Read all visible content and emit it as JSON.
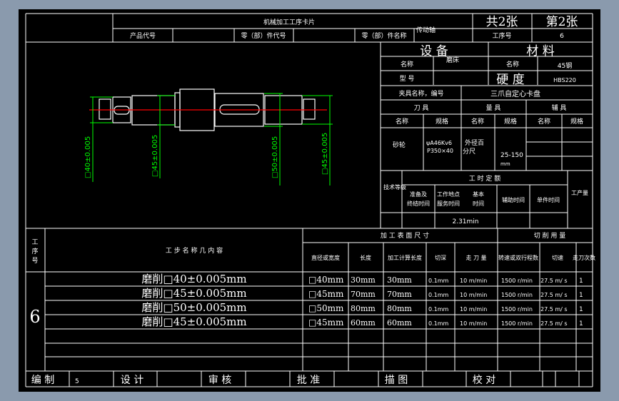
{
  "header": {
    "title": "机械加工工序卡片",
    "total_sheets": "共2张",
    "sheet_no": "第2张",
    "product_code_label": "产品代号",
    "part_code_label": "零（部）件代号",
    "part_name_label": "零（部）件名称",
    "part_name": "传动轴",
    "operation_no_label": "工序号",
    "operation_no": "6"
  },
  "equipment": {
    "title": "设 备",
    "name_label": "名称",
    "name": "磨床",
    "model_label": "型 号",
    "model": ""
  },
  "material": {
    "title": "材 料",
    "name_label": "名称",
    "name": "45钢",
    "hardness_label": "硬 度",
    "hardness": "HBS220"
  },
  "fixture": {
    "label": "夹具名称，编号",
    "value": "三爪自定心卡盘"
  },
  "tools": {
    "cutting_tool": "刀 具",
    "measuring_tool": "量 具",
    "aux_tool": "辅 具",
    "name_label": "名称",
    "spec_label": "规格",
    "cutting_name": "砂轮",
    "cutting_spec_1": "ψA46Kv6",
    "cutting_spec_2": "P350×40",
    "measuring_name_1": "外径百",
    "measuring_name_2": "分尺",
    "measuring_spec_1": "25-150",
    "measuring_spec_2": "mm"
  },
  "time_quota": {
    "tech_level": "技术等级",
    "title": "工 时 定 额",
    "prep_time_1": "准备及",
    "prep_time_2": "终结时间",
    "service_time_1": "工作地点",
    "service_time_2": "服务时间",
    "basic_time_1": "基本",
    "basic_time_2": "时间",
    "aux_time": "辅助时间",
    "unit_time": "单件时间",
    "output": "工产量",
    "basic_time_value": "2.31min"
  },
  "drawing": {
    "dims": [
      "□40±0.005",
      "□45±0.005",
      "□50±0.005",
      "□45±0.005"
    ],
    "line_color": "#00ff00",
    "centerline_color": "#ff0000"
  },
  "steps_table": {
    "op_no_label": "工序号",
    "content_label": "工 步 名 称 几 内 容",
    "surface_size_label": "加 工 表 面 尺 寸",
    "cutting_label": "切 削 用 量",
    "columns": [
      "直径或宽度",
      "长度",
      "加工计算长度",
      "切深",
      "走 刀 量",
      "转速或双行程数",
      "切速",
      "走刀次数"
    ],
    "op_no": "6",
    "rows": [
      {
        "content": "磨削□40±0.005mm",
        "dia": "□40mm",
        "len": "30mm",
        "calc_len": "30mm",
        "depth": "0.1mm",
        "feed": "10 m/min",
        "speed": "1500 r/min",
        "cut_speed": "27.5 m/ s",
        "passes": "1"
      },
      {
        "content": "磨削□45±0.005mm",
        "dia": "□45mm",
        "len": "70mm",
        "calc_len": "70mm",
        "depth": "0.1mm",
        "feed": "10 m/min",
        "speed": "1500 r/min",
        "cut_speed": "27.5 m/ s",
        "passes": "1"
      },
      {
        "content": "磨削□50±0.005mm",
        "dia": "□50mm",
        "len": "80mm",
        "calc_len": "80mm",
        "depth": "0.1mm",
        "feed": "10 m/min",
        "speed": "1500 r/min",
        "cut_speed": "27.5 m/ s",
        "passes": "1"
      },
      {
        "content": "磨削□45±0.005mm",
        "dia": "□45mm",
        "len": "60mm",
        "calc_len": "60mm",
        "depth": "0.1mm",
        "feed": "10 m/min",
        "speed": "1500 r/min",
        "cut_speed": "27.5 m/ s",
        "passes": "1"
      }
    ]
  },
  "footer": {
    "compiled": "编 制",
    "compiled_value": "5",
    "design": "设 计",
    "review": "审 核",
    "approve": "批 准",
    "trace": "描 图",
    "check": "校 对"
  }
}
